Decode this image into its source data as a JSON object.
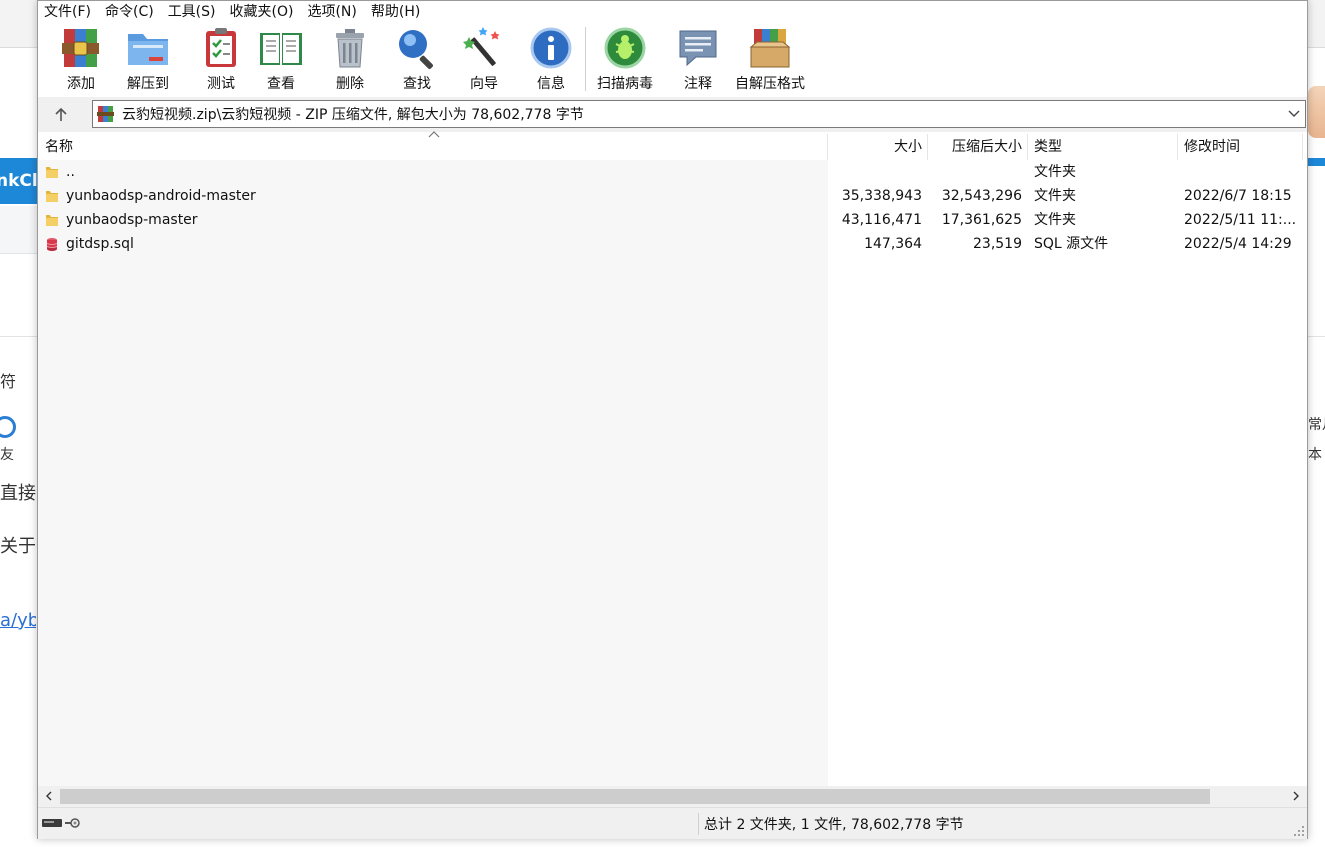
{
  "background_page": {
    "brand_fragment": "nkCl",
    "text_fu": "符",
    "text_friend": "友",
    "text_direct": "直接",
    "text_about": "关于",
    "link_fragment": "a/yb/",
    "text_common": "常月",
    "text_ben": "本"
  },
  "menu": [
    {
      "label": "文件(F)"
    },
    {
      "label": "命令(C)"
    },
    {
      "label": "工具(S)"
    },
    {
      "label": "收藏夹(O)"
    },
    {
      "label": "选项(N)"
    },
    {
      "label": "帮助(H)"
    }
  ],
  "toolbar": {
    "add": "添加",
    "extract_to": "解压到",
    "test": "测试",
    "view": "查看",
    "delete": "删除",
    "find": "查找",
    "wizard": "向导",
    "info": "信息",
    "virus_scan": "扫描病毒",
    "comment": "注释",
    "sfx": "自解压格式"
  },
  "address": {
    "path": "云豹短视频.zip\\云豹短视频 - ZIP 压缩文件, 解包大小为 78,602,778 字节"
  },
  "columns": {
    "name": "名称",
    "size": "大小",
    "packed": "压缩后大小",
    "type": "类型",
    "modified": "修改时间"
  },
  "files": [
    {
      "name": "..",
      "size": "",
      "packed": "",
      "type": "文件夹",
      "modified": "",
      "icon": "folder-icon"
    },
    {
      "name": "yunbaodsp-android-master",
      "size": "35,338,943",
      "packed": "32,543,296",
      "type": "文件夹",
      "modified": "2022/6/7 18:15",
      "icon": "folder-icon"
    },
    {
      "name": "yunbaodsp-master",
      "size": "43,116,471",
      "packed": "17,361,625",
      "type": "文件夹",
      "modified": "2022/5/11 11:...",
      "icon": "folder-icon"
    },
    {
      "name": "gitdsp.sql",
      "size": "147,364",
      "packed": "23,519",
      "type": "SQL 源文件",
      "modified": "2022/5/4 14:29",
      "icon": "sql-file-icon"
    }
  ],
  "status": {
    "summary": "总计 2 文件夹, 1 文件, 78,602,778 字节"
  },
  "colors": {
    "folder": "#f2c14e",
    "window_bg": "#f0f0f0",
    "list_bg": "#ffffff",
    "list_shade": "#f7f7f7",
    "accent_blue": "#1e88d8"
  }
}
